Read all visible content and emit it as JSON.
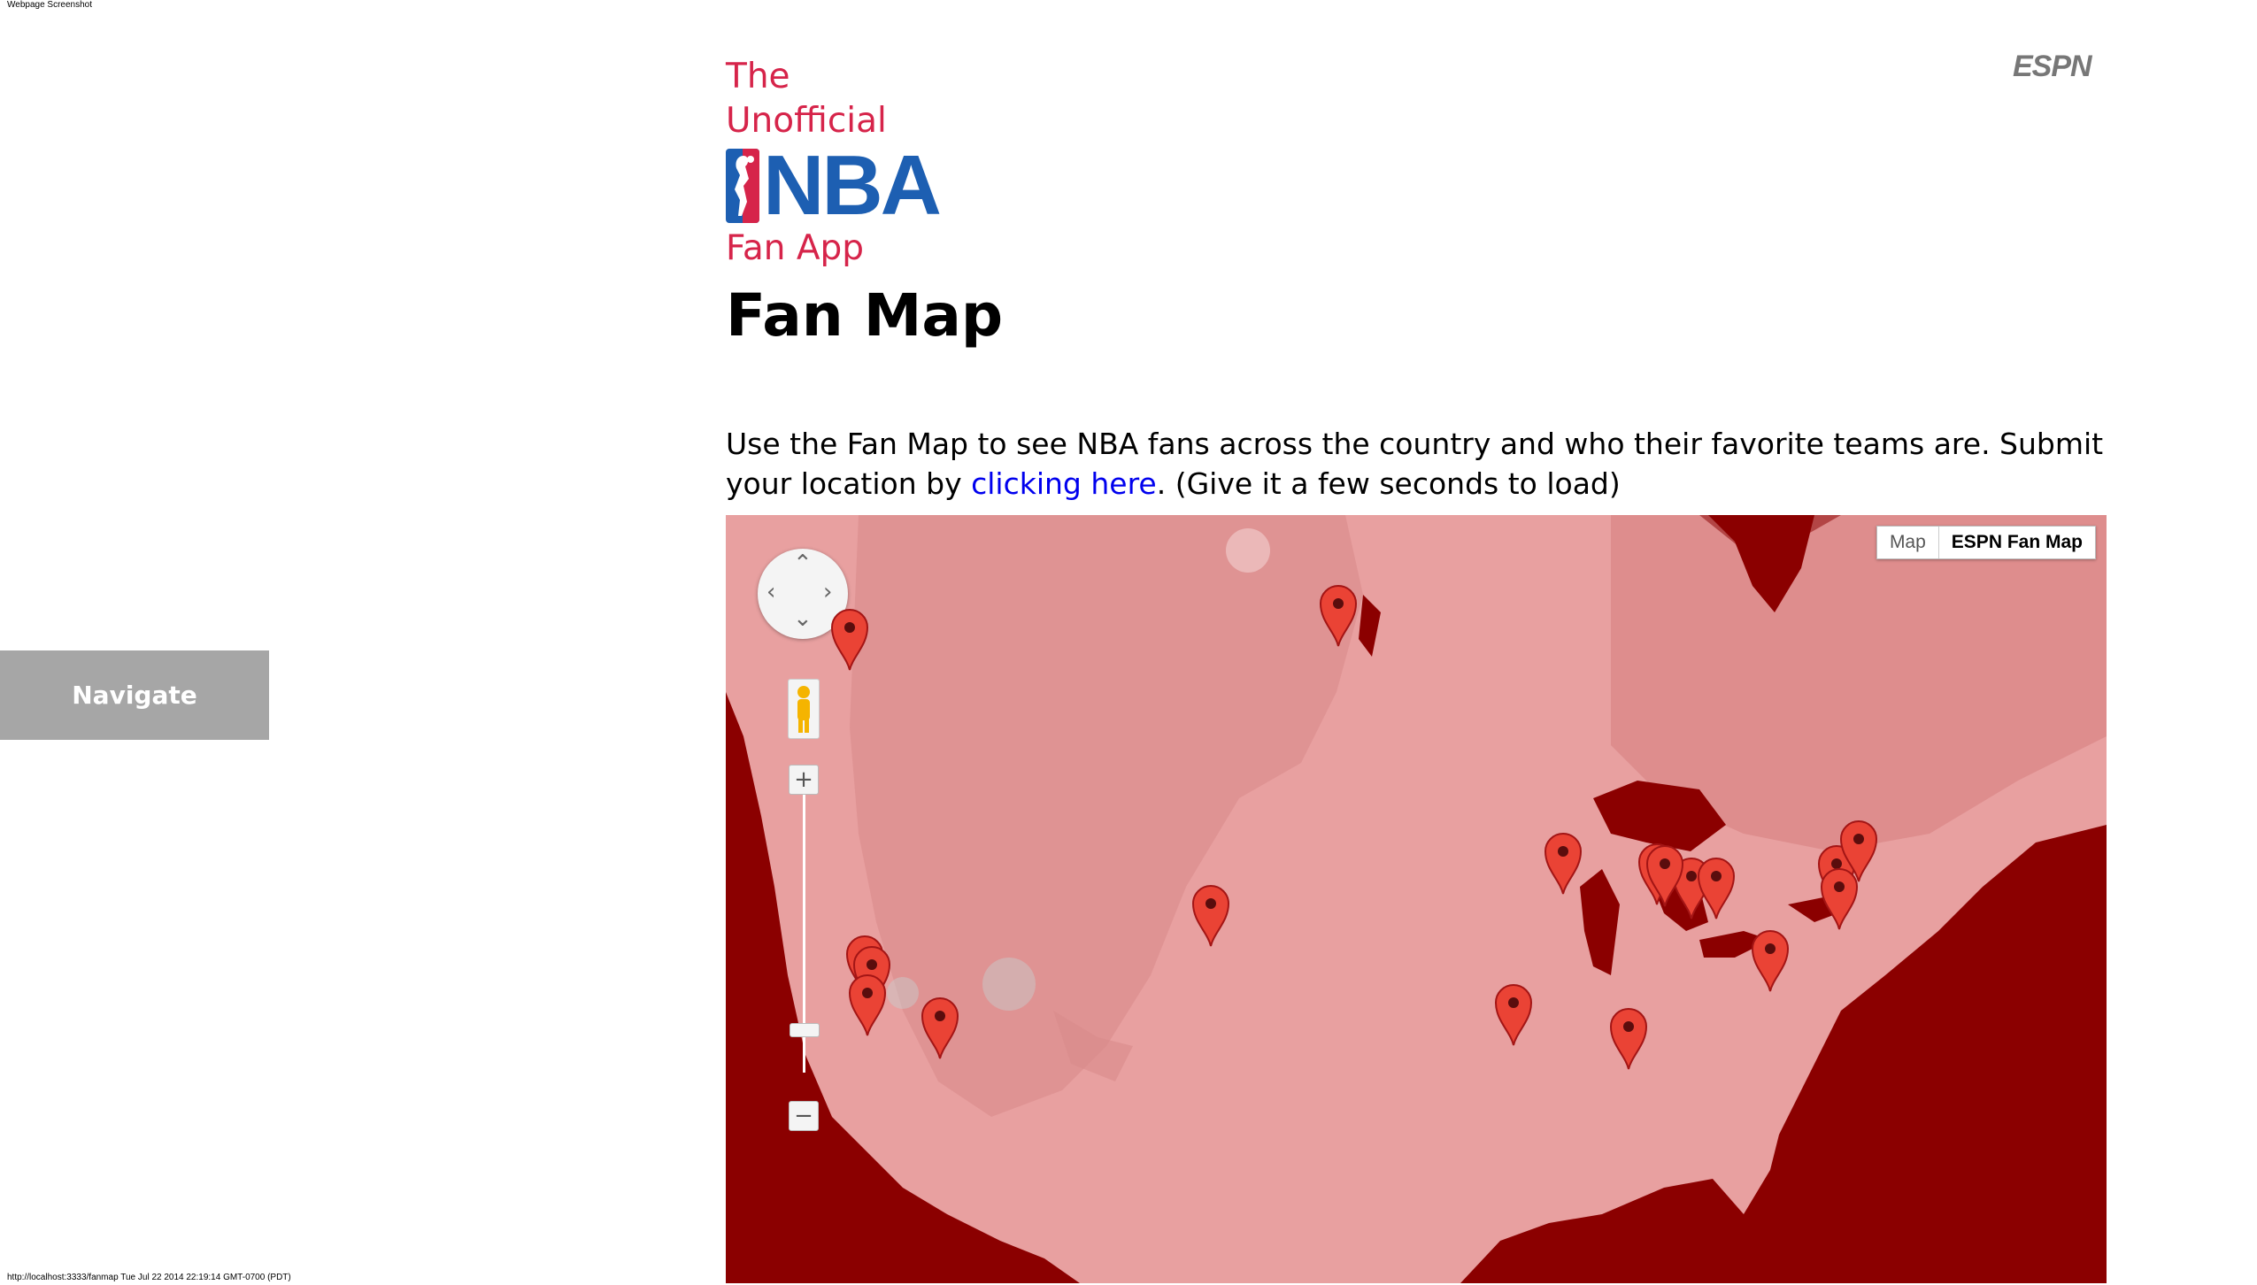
{
  "screenshot": {
    "title": "Webpage Screenshot",
    "footer": "http://localhost:3333/fanmap Tue Jul 22 2014 22:19:14 GMT-0700 (PDT)"
  },
  "nav": {
    "navigate_label": "Navigate"
  },
  "logo": {
    "line1": "The Unofficial",
    "nba": "NBA",
    "line2": "Fan App"
  },
  "brand": {
    "espn": "ESPN"
  },
  "page": {
    "title": "Fan Map",
    "intro_before": "Use the Fan Map to see NBA fans across the country and who their favorite teams are. Submit your location by ",
    "intro_link": "clicking here",
    "intro_after": ". (Give it a few seconds to load)"
  },
  "map": {
    "type_map": "Map",
    "type_espn": "ESPN Fan Map",
    "marker_count": 20,
    "colors": {
      "ocean": "#8b0000",
      "land": "#e8a0a0",
      "marker": "#ea4335",
      "accent_red": "#d6244a",
      "nba_blue": "#1d5fb2",
      "link": "#0000ee"
    }
  }
}
